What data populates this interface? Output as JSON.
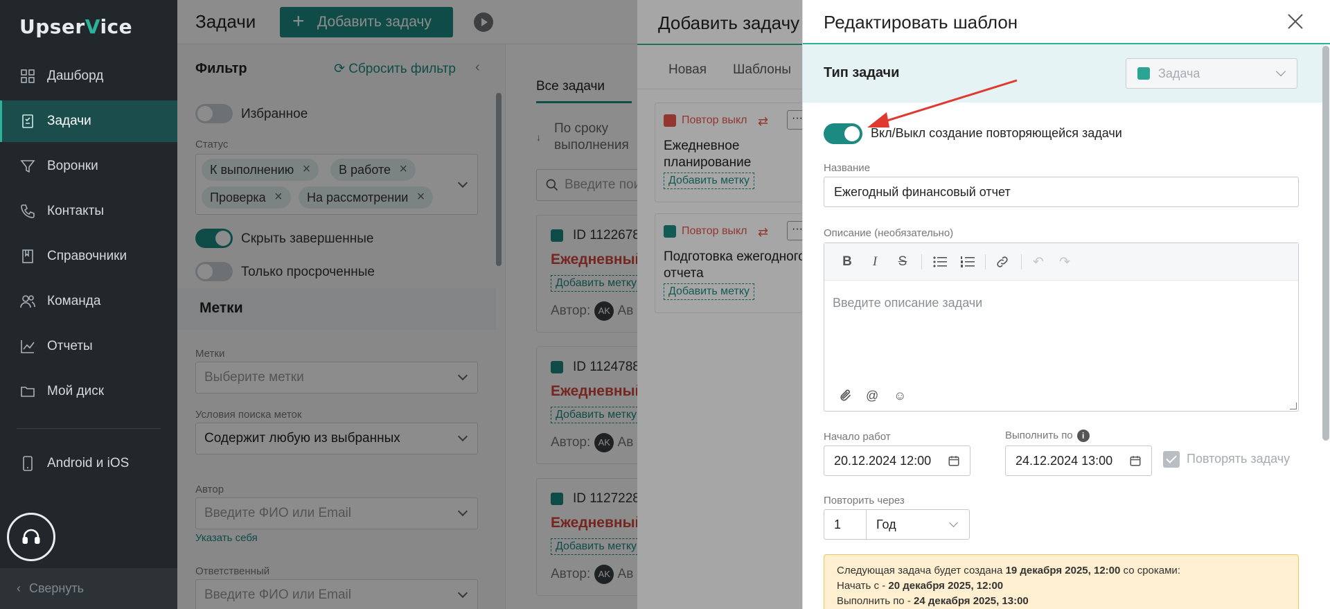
{
  "app": {
    "logo_prefix": "Upser",
    "logo_mark": "V",
    "logo_suffix": "ice"
  },
  "sidebar": {
    "items": [
      {
        "label": "Дашборд"
      },
      {
        "label": "Задачи"
      },
      {
        "label": "Воронки"
      },
      {
        "label": "Контакты"
      },
      {
        "label": "Справочники"
      },
      {
        "label": "Команда"
      },
      {
        "label": "Отчеты"
      },
      {
        "label": "Мой диск"
      },
      {
        "label": "Android и iOS"
      }
    ],
    "collapse_label": "Свернуть"
  },
  "header": {
    "title": "Задачи",
    "add_task": "Добавить задачу"
  },
  "filter": {
    "title": "Фильтр",
    "reset": "Сбросить фильтр",
    "favorite": "Избранное",
    "status_label": "Статус",
    "status_chips": [
      "К выполнению",
      "В работе",
      "Проверка",
      "На рассмотрении"
    ],
    "hide_done": "Скрыть завершенные",
    "only_overdue": "Только просроченные",
    "tags_section": "Метки",
    "tags_label": "Метки",
    "tags_placeholder": "Выберите метки",
    "search_cond_label": "Условия поиска меток",
    "search_cond_value": "Содержит любую из выбранных",
    "author_label": "Автор",
    "author_placeholder": "Введите ФИО или Email",
    "self_link": "Указать себя",
    "responsible_label": "Ответственный",
    "responsible_placeholder": "Введите ФИО или Email"
  },
  "list": {
    "tab_all": "Все задачи",
    "sort": "По сроку выполнения",
    "search_placeholder": "Введите пои",
    "cards": [
      {
        "id": "ID 1122678",
        "title": "Ежедневный",
        "tag": "Добавить метку",
        "author": "Автор:",
        "avatar": "AK",
        "name": "Ав"
      },
      {
        "id": "ID 1124788",
        "title": "Ежедневный",
        "tag": "Добавить метку",
        "author": "Автор:",
        "avatar": "AK",
        "name": "Ав"
      },
      {
        "id": "ID 1127228",
        "title": "Ежедневный",
        "tag": "Добавить метку",
        "author": "Автор:",
        "avatar": "AK",
        "name": "Ав"
      }
    ]
  },
  "add_drawer": {
    "title": "Добавить задачу",
    "tabs": [
      "Новая",
      "Шаблоны"
    ],
    "templates": [
      {
        "kind": "Повтор выкл",
        "name": "Ежедневное планирование",
        "tag": "Добавить метку"
      },
      {
        "kind": "Повтор выкл",
        "name": "Подготовка ежегодного отчета",
        "tag": "Добавить метку"
      }
    ],
    "menu": "···"
  },
  "edit_drawer": {
    "title": "Редактировать шаблон",
    "type_label": "Тип задачи",
    "type_value": "Задача",
    "repeat_toggle_label": "Вкл/Выкл создание повторяющейся задачи",
    "name_label": "Название",
    "name_value": "Ежегодный финансовый отчет",
    "desc_label": "Описание (необязательно)",
    "desc_placeholder": "Введите описание задачи",
    "start_label": "Начало работ",
    "start_value": "20.12.2024 12:00",
    "due_label": "Выполнить по",
    "due_value": "24.12.2024 13:00",
    "repeat_check_label": "Повторять задачу",
    "repeat_every_label": "Повторить через",
    "repeat_count": "1",
    "repeat_unit": "Год",
    "notice": {
      "l1_pre": "Следующая задача будет создана ",
      "l1_bold": "19 декабря 2025, 12:00",
      "l1_post": " со сроками:",
      "l2_pre": "Начать с - ",
      "l2_bold": "20 декабря 2025, 12:00",
      "l3_pre": "Выполнить по - ",
      "l3_bold": "24 декабря 2025, 13:00"
    }
  },
  "colors": {
    "accent": "#1d8a82",
    "sidebar_bg": "#22272b",
    "danger": "#d6453b",
    "notice_bg": "#fdefcf"
  }
}
